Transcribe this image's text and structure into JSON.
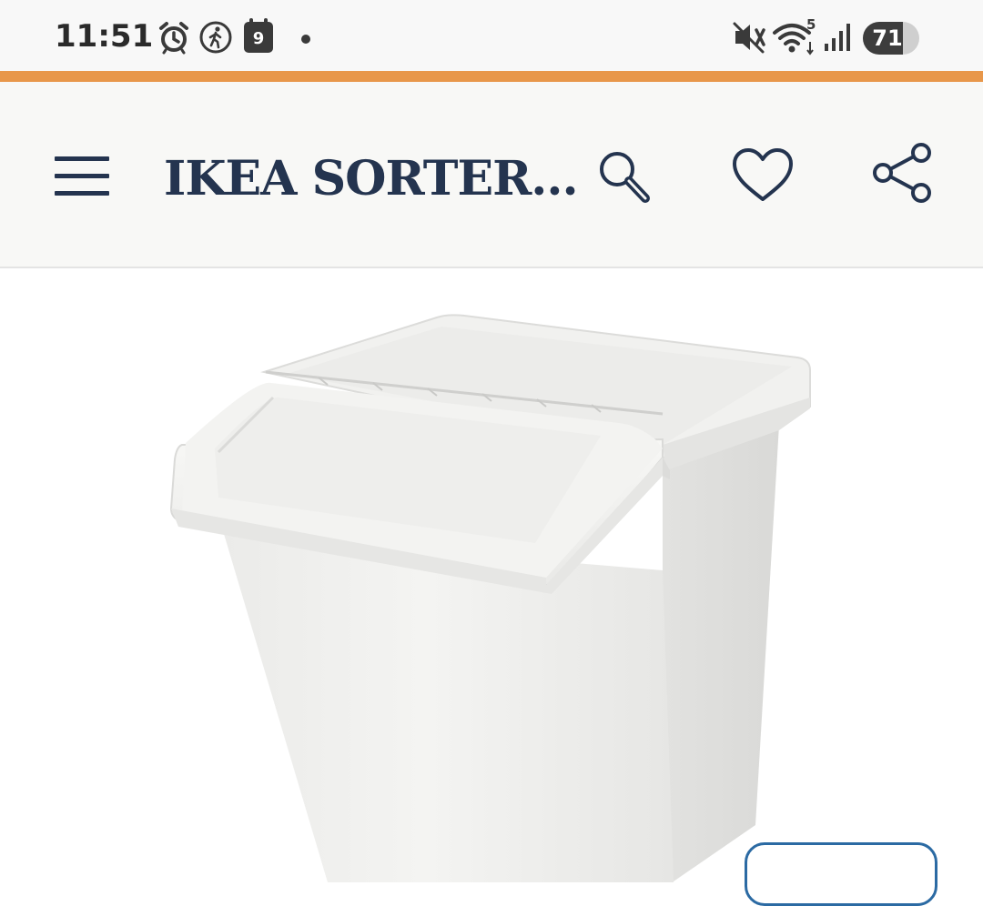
{
  "status_bar": {
    "time": "11:51",
    "calendar_day": "9",
    "battery_percent": 71,
    "battery_label": "71",
    "wifi_label": "5",
    "icons": [
      "alarm-icon",
      "walking-icon",
      "calendar-icon",
      "notification-dot",
      "mute-icon",
      "wifi-icon",
      "signal-icon",
      "battery-icon"
    ]
  },
  "colors": {
    "accent": "#e8974a",
    "brand_navy": "#24344f",
    "button_border": "#2b6aa3"
  },
  "header": {
    "title": "IKEA SORTER...",
    "icons": [
      "menu-icon",
      "search-icon",
      "heart-icon",
      "share-icon"
    ]
  },
  "product": {
    "image": "white-sorting-bin-with-lid"
  }
}
